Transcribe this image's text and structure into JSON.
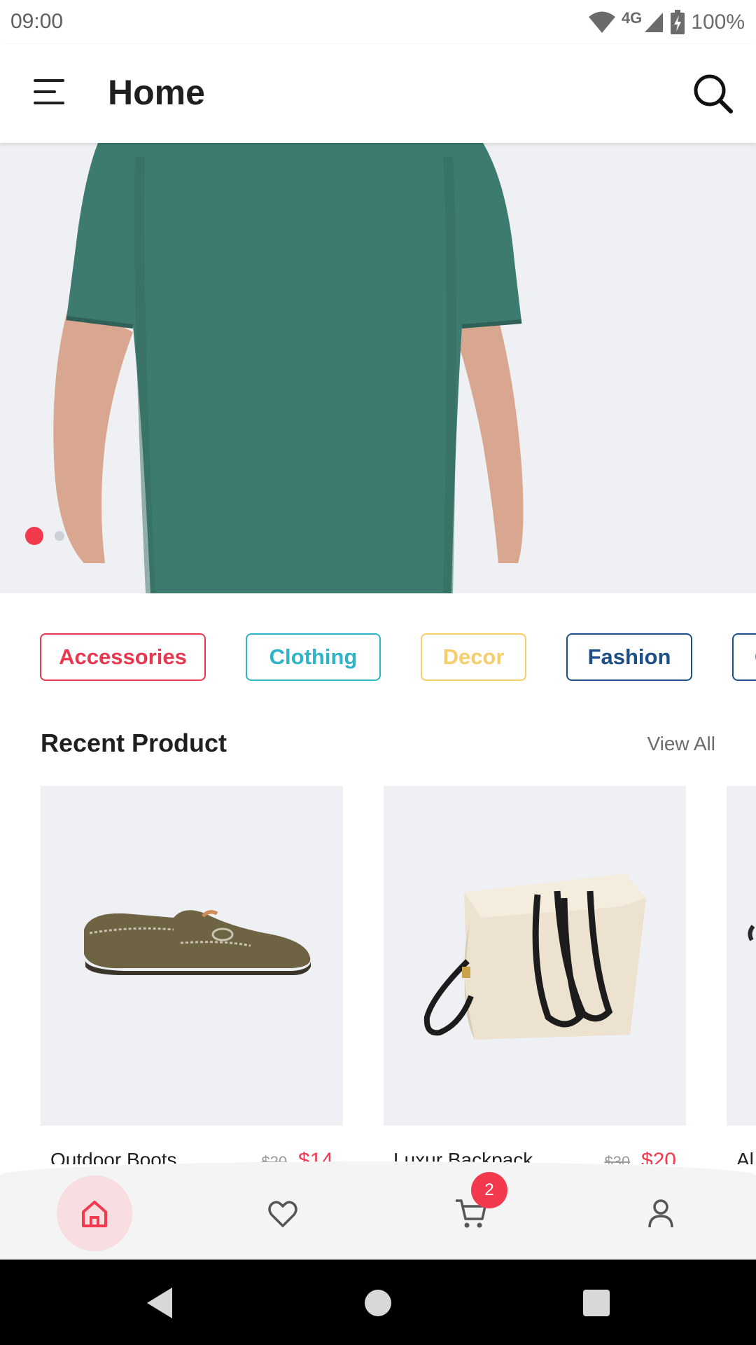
{
  "status_bar": {
    "time": "09:00",
    "network": "4G",
    "battery": "100%"
  },
  "app_bar": {
    "title": "Home",
    "menu_icon": "hamburger-menu-icon",
    "search_icon": "search-icon"
  },
  "hero": {
    "slide_count": 2,
    "active_slide": 1
  },
  "categories": [
    {
      "label": "Accessories",
      "color": "#e8384f"
    },
    {
      "label": "Clothing",
      "color": "#2fb3c6"
    },
    {
      "label": "Decor",
      "color": "#f5cd6a"
    },
    {
      "label": "Fashion",
      "color": "#1c4f86"
    },
    {
      "label": "G",
      "color": "#1c4f86"
    }
  ],
  "recent": {
    "title": "Recent Product",
    "view_all": "View All",
    "products": [
      {
        "name": "Outdoor Boots",
        "old_price": "$20",
        "price": "$14"
      },
      {
        "name": "Luxur Backpack",
        "old_price": "$30",
        "price": "$20"
      },
      {
        "name": "Al",
        "old_price": "",
        "price": ""
      }
    ]
  },
  "bottom_nav": {
    "items": [
      "home-icon",
      "heart-icon",
      "cart-icon",
      "user-icon"
    ],
    "active": "home-icon",
    "cart_badge": "2"
  },
  "system_nav": [
    "back-icon",
    "home-circle-icon",
    "recents-icon"
  ],
  "colors": {
    "accent": "#f2394e",
    "hero_bg": "#eef0f4",
    "shirt": "#3d7a6f"
  }
}
